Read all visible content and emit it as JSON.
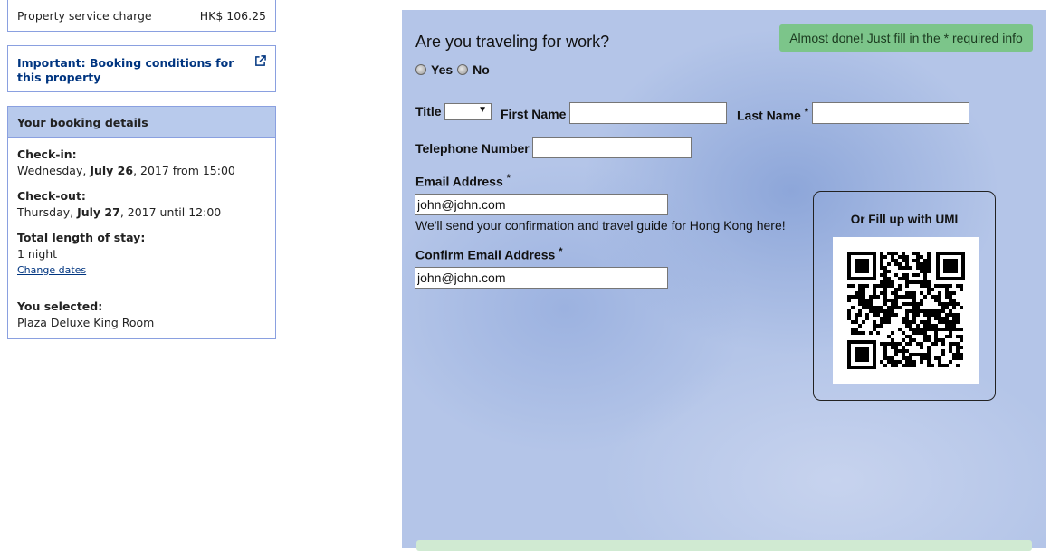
{
  "sidebar": {
    "charge": {
      "label": "Property service charge",
      "amount": "HK$ 106.25"
    },
    "important": {
      "text": "Important: Booking conditions for this property",
      "icon": "external-link-icon"
    },
    "details": {
      "title": "Your booking details",
      "checkin_label": "Check-in:",
      "checkin_day": "Wednesday, ",
      "checkin_date": "July 26",
      "checkin_rest": ", 2017 from 15:00",
      "checkout_label": "Check-out:",
      "checkout_day": "Thursday, ",
      "checkout_date": "July 27",
      "checkout_rest": ", 2017 until 12:00",
      "length_label": "Total length of stay:",
      "length_value": "1 night",
      "change_dates": "Change dates",
      "selected_label": "You selected:",
      "selected_value": "Plaza Deluxe King Room"
    }
  },
  "form": {
    "notice": "Almost done! Just fill in the * required info",
    "question": "Are you traveling for work?",
    "radio_yes": "Yes",
    "radio_no": "No",
    "title_label": "Title",
    "title_value": "",
    "title_arrow": "▼",
    "first_name_label": "First Name",
    "first_name_value": "",
    "last_name_label": "Last Name",
    "required_mark": "*",
    "last_name_value": "",
    "telephone_label": "Telephone Number",
    "telephone_value": "",
    "email_label": "Email Address",
    "email_value": "john@john.com",
    "email_hint": "We'll send your confirmation and travel guide for Hong Kong here!",
    "confirm_email_label": "Confirm Email Address",
    "confirm_email_value": "john@john.com",
    "umi_title": "Or Fill up with UMI"
  },
  "colors": {
    "brand_blue": "#003580",
    "notice_green": "#7cc58a",
    "panel_blue": "#b4c5e8"
  }
}
